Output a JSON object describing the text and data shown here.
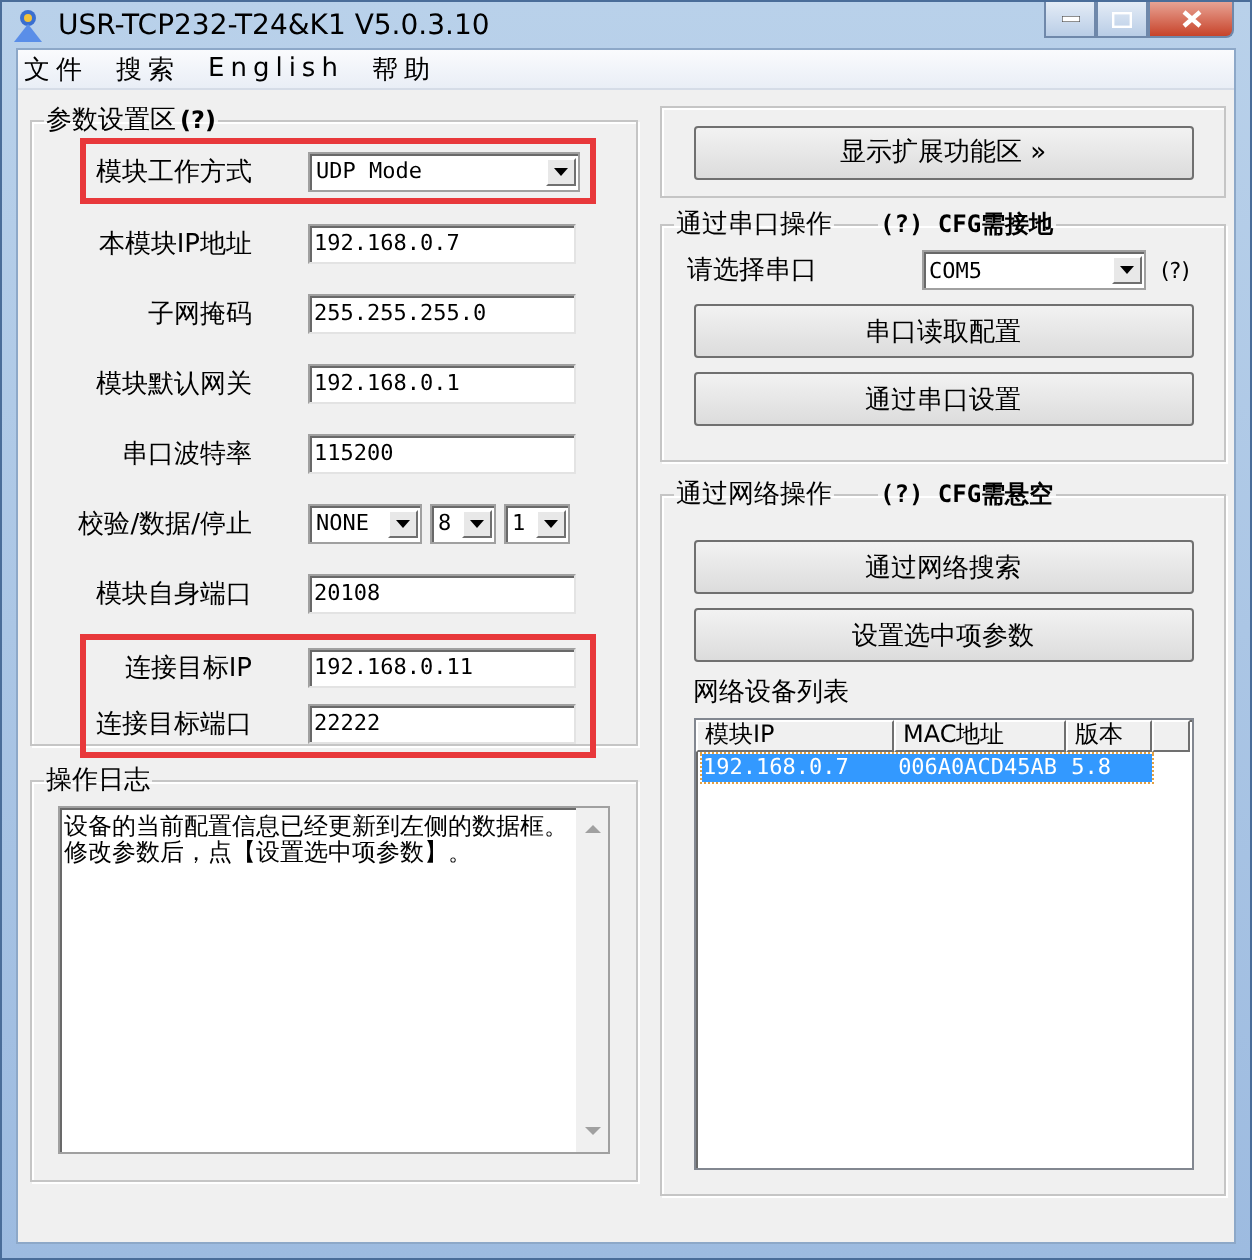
{
  "window": {
    "title": "USR-TCP232-T24&K1 V5.0.3.10"
  },
  "menu": [
    "文件",
    "搜索",
    "English",
    "帮助"
  ],
  "params": {
    "title": "参数设置区",
    "help": "(?)",
    "fields": [
      {
        "kind": "dropdown",
        "label": "模块工作方式",
        "value": "UDP Mode",
        "highlighted": true
      },
      {
        "kind": "text",
        "label": "本模块IP地址",
        "value": "192.168.0.7",
        "highlighted": false
      },
      {
        "kind": "text",
        "label": "子网掩码",
        "value": "255.255.255.0",
        "highlighted": false
      },
      {
        "kind": "text",
        "label": "模块默认网关",
        "value": "192.168.0.1",
        "highlighted": false
      },
      {
        "kind": "text",
        "label": "串口波特率",
        "value": "115200",
        "highlighted": false
      },
      {
        "kind": "triple",
        "label": "校验/数据/停止",
        "values": [
          "NONE",
          "8",
          "1"
        ],
        "highlighted": false
      },
      {
        "kind": "text",
        "label": "模块自身端口",
        "value": "20108",
        "highlighted": false
      },
      {
        "kind": "text",
        "label": "连接目标IP",
        "value": "192.168.0.11",
        "highlighted": true
      },
      {
        "kind": "text",
        "label": "连接目标端口",
        "value": "22222",
        "highlighted": true
      }
    ]
  },
  "log": {
    "title": "操作日志",
    "lines": [
      "设备的当前配置信息已经更新到左侧的数据框。",
      "修改参数后，点【设置选中项参数】。"
    ]
  },
  "extend_button": "显示扩展功能区 »",
  "serial": {
    "title": "通过串口操作",
    "note": "(?) CFG需接地",
    "port_label": "请选择串口",
    "port": "COM5",
    "help": "(?)",
    "buttons": [
      "串口读取配置",
      "通过串口设置"
    ]
  },
  "network": {
    "title": "通过网络操作",
    "note": "(?) CFG需悬空",
    "buttons": [
      "通过网络搜索",
      "设置选中项参数"
    ],
    "list_label": "网络设备列表",
    "columns": [
      "模块IP",
      "MAC地址",
      "版本"
    ],
    "rows": [
      {
        "cells": [
          "192.168.0.7",
          "006A0ACD45AB",
          "5.8"
        ],
        "selected": true
      }
    ]
  }
}
